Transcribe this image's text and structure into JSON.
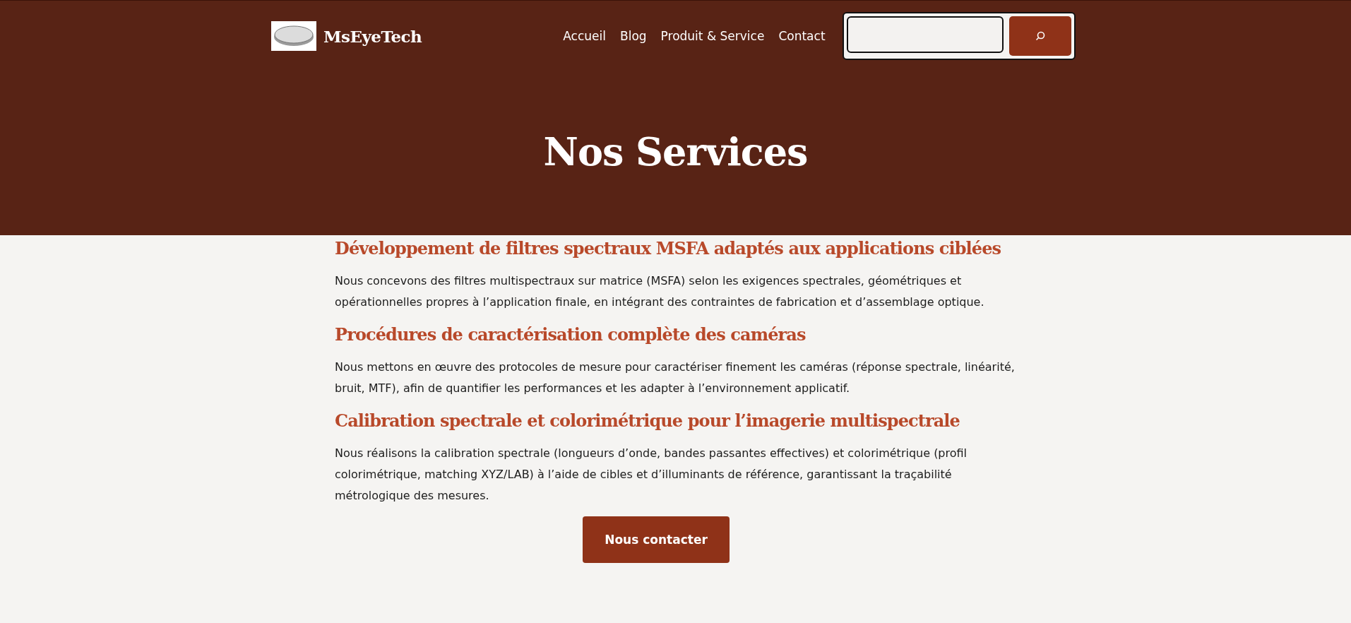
{
  "header": {
    "brand": "MsEyeTech",
    "nav": [
      {
        "label": "Accueil"
      },
      {
        "label": "Blog"
      },
      {
        "label": "Produit & Service"
      },
      {
        "label": "Contact"
      }
    ]
  },
  "hero": {
    "title": "Nos Services"
  },
  "sections": [
    {
      "heading": "Développement de filtres spectraux MSFA adaptés aux applications ciblées",
      "text": "Nous concevons des filtres multispectraux sur matrice (MSFA) selon les exigences spectrales, géométriques et opérationnelles propres à l’application finale, en intégrant des contraintes de fabrication et d’assemblage optique."
    },
    {
      "heading": "Procédures de caractérisation complète des caméras",
      "text": "Nous mettons en œuvre des protocoles de mesure pour caractériser finement les caméras (réponse spectrale, linéarité, bruit, MTF), afin de quantifier les performances et les adapter à l’environnement applicatif."
    },
    {
      "heading": "Calibration spectrale et colorimétrique pour l’imagerie multispectrale",
      "text": "Nous réalisons la calibration spectrale (longueurs d’onde, bandes passantes effectives) et colorimétrique (profil colorimétrique, matching XYZ/LAB) à l’aide de cibles et d’illuminants de référence, garantissant la traçabilité métrologique des mesures."
    }
  ],
  "cta": {
    "label": "Nous contacter"
  }
}
